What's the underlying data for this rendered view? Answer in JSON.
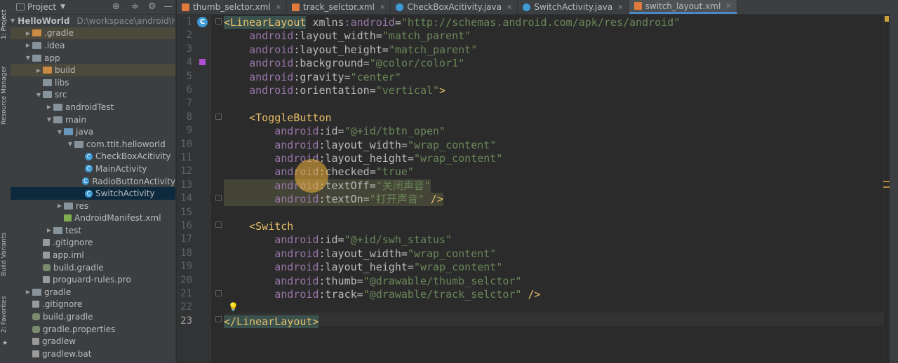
{
  "left_strip": {
    "tabs": [
      "1: Project",
      "Resource Manager",
      "Build Variants",
      "2: Favorites"
    ]
  },
  "project_panel": {
    "title": "Project",
    "toolbar_icons": [
      "globe-icon",
      "equalizer-icon",
      "gear-icon",
      "minimize-icon"
    ],
    "tree": [
      {
        "label": "HelloWorld",
        "extra": "D:\\workspace\\android\\Hel",
        "indent": 0,
        "arrow": "down",
        "icon": "folder"
      },
      {
        "label": ".gradle",
        "indent": 1,
        "arrow": "right",
        "icon": "folder-orange",
        "highlight": true
      },
      {
        "label": ".idea",
        "indent": 1,
        "arrow": "right",
        "icon": "folder"
      },
      {
        "label": "app",
        "indent": 1,
        "arrow": "down",
        "icon": "folder"
      },
      {
        "label": "build",
        "indent": 2,
        "arrow": "right",
        "icon": "folder-orange",
        "highlight": true
      },
      {
        "label": "libs",
        "indent": 2,
        "arrow": "",
        "icon": "folder"
      },
      {
        "label": "src",
        "indent": 2,
        "arrow": "down",
        "icon": "folder"
      },
      {
        "label": "androidTest",
        "indent": 3,
        "arrow": "right",
        "icon": "folder"
      },
      {
        "label": "main",
        "indent": 3,
        "arrow": "down",
        "icon": "folder"
      },
      {
        "label": "java",
        "indent": 4,
        "arrow": "down",
        "icon": "folder-blue"
      },
      {
        "label": "com.ttit.helloworld",
        "indent": 5,
        "arrow": "down",
        "icon": "folder"
      },
      {
        "label": "CheckBoxAcitivity",
        "indent": 6,
        "arrow": "",
        "icon": "class"
      },
      {
        "label": "MainActivity",
        "indent": 6,
        "arrow": "",
        "icon": "class"
      },
      {
        "label": "RadioButtonActivity",
        "indent": 6,
        "arrow": "",
        "icon": "class"
      },
      {
        "label": "SwitchActivity",
        "indent": 6,
        "arrow": "",
        "icon": "class",
        "selected": true
      },
      {
        "label": "res",
        "indent": 4,
        "arrow": "right",
        "icon": "folder"
      },
      {
        "label": "AndroidManifest.xml",
        "indent": 4,
        "arrow": "",
        "icon": "xml"
      },
      {
        "label": "test",
        "indent": 3,
        "arrow": "right",
        "icon": "folder"
      },
      {
        "label": ".gitignore",
        "indent": 2,
        "arrow": "",
        "icon": "file"
      },
      {
        "label": "app.iml",
        "indent": 2,
        "arrow": "",
        "icon": "file"
      },
      {
        "label": "build.gradle",
        "indent": 2,
        "arrow": "",
        "icon": "gradle"
      },
      {
        "label": "proguard-rules.pro",
        "indent": 2,
        "arrow": "",
        "icon": "file"
      },
      {
        "label": "gradle",
        "indent": 1,
        "arrow": "right",
        "icon": "folder"
      },
      {
        "label": ".gitignore",
        "indent": 1,
        "arrow": "",
        "icon": "file"
      },
      {
        "label": "build.gradle",
        "indent": 1,
        "arrow": "",
        "icon": "gradle"
      },
      {
        "label": "gradle.properties",
        "indent": 1,
        "arrow": "",
        "icon": "gradle"
      },
      {
        "label": "gradlew",
        "indent": 1,
        "arrow": "",
        "icon": "file"
      },
      {
        "label": "gradlew.bat",
        "indent": 1,
        "arrow": "",
        "icon": "file"
      }
    ]
  },
  "editor_tabs": [
    {
      "label": "thumb_selctor.xml",
      "icon": "xml"
    },
    {
      "label": "track_selctor.xml",
      "icon": "xml"
    },
    {
      "label": "CheckBoxAcitivity.java",
      "icon": "class"
    },
    {
      "label": "SwitchActivity.java",
      "icon": "class"
    },
    {
      "label": "switch_layout.xml",
      "icon": "xml",
      "active": true
    }
  ],
  "editor": {
    "current_line": 23,
    "line_numbers": [
      "1",
      "2",
      "3",
      "4",
      "5",
      "6",
      "7",
      "8",
      "9",
      "10",
      "11",
      "12",
      "13",
      "14",
      "15",
      "16",
      "17",
      "18",
      "19",
      "20",
      "21",
      "22",
      "23"
    ],
    "lines": [
      [
        [
          "t",
          "<LinearLayout"
        ],
        [
          "at",
          " xmlns"
        ],
        [
          "ns",
          ":android"
        ],
        [
          "at",
          "="
        ],
        [
          "v",
          "\"http://schemas.android.com/apk/res/android\""
        ]
      ],
      [
        [
          "ns",
          "    android"
        ],
        [
          "at",
          ":layout_width="
        ],
        [
          "v",
          "\"match_parent\""
        ]
      ],
      [
        [
          "ns",
          "    android"
        ],
        [
          "at",
          ":layout_height="
        ],
        [
          "v",
          "\"match_parent\""
        ]
      ],
      [
        [
          "ns",
          "    android"
        ],
        [
          "at",
          ":background="
        ],
        [
          "v",
          "\"@color/color1\""
        ]
      ],
      [
        [
          "ns",
          "    android"
        ],
        [
          "at",
          ":gravity="
        ],
        [
          "v",
          "\"center\""
        ]
      ],
      [
        [
          "ns",
          "    android"
        ],
        [
          "at",
          ":orientation="
        ],
        [
          "v",
          "\"vertical\""
        ],
        [
          "t",
          ">"
        ]
      ],
      [],
      [
        [
          "t",
          "    <ToggleButton"
        ]
      ],
      [
        [
          "ns",
          "        android"
        ],
        [
          "at",
          ":id="
        ],
        [
          "v",
          "\"@+id/tbtn_open\""
        ]
      ],
      [
        [
          "ns",
          "        android"
        ],
        [
          "at",
          ":layout_width="
        ],
        [
          "v",
          "\"wrap_content\""
        ]
      ],
      [
        [
          "ns",
          "        android"
        ],
        [
          "at",
          ":layout_height="
        ],
        [
          "v",
          "\"wrap_content\""
        ]
      ],
      [
        [
          "ns",
          "        android"
        ],
        [
          "at",
          ":checked="
        ],
        [
          "v",
          "\"true\""
        ]
      ],
      [
        [
          "ns",
          "        android"
        ],
        [
          "at",
          ":textOff="
        ],
        [
          "v",
          "\"关闭声音\""
        ]
      ],
      [
        [
          "ns",
          "        android"
        ],
        [
          "at",
          ":textOn="
        ],
        [
          "v",
          "\"打开声音\""
        ],
        [
          "t",
          " />"
        ]
      ],
      [],
      [
        [
          "t",
          "    <Switch"
        ]
      ],
      [
        [
          "ns",
          "        android"
        ],
        [
          "at",
          ":id="
        ],
        [
          "v",
          "\"@+id/swh_status\""
        ]
      ],
      [
        [
          "ns",
          "        android"
        ],
        [
          "at",
          ":layout_width="
        ],
        [
          "v",
          "\"wrap_content\""
        ]
      ],
      [
        [
          "ns",
          "        android"
        ],
        [
          "at",
          ":layout_height="
        ],
        [
          "v",
          "\"wrap_content\""
        ]
      ],
      [
        [
          "ns",
          "        android"
        ],
        [
          "at",
          ":thumb="
        ],
        [
          "v",
          "\"@drawable/thumb_selctor\""
        ]
      ],
      [
        [
          "ns",
          "        android"
        ],
        [
          "at",
          ":track="
        ],
        [
          "v",
          "\"@drawable/track_selctor\""
        ],
        [
          "t",
          " />"
        ]
      ],
      [],
      [
        [
          "t",
          "</LinearLayout>"
        ]
      ]
    ]
  },
  "colors": {
    "tag": "#e8bf6a",
    "namespace": "#9876aa",
    "attribute": "#bababa",
    "value": "#6a8759",
    "background_swatch": "#b04fd6"
  }
}
